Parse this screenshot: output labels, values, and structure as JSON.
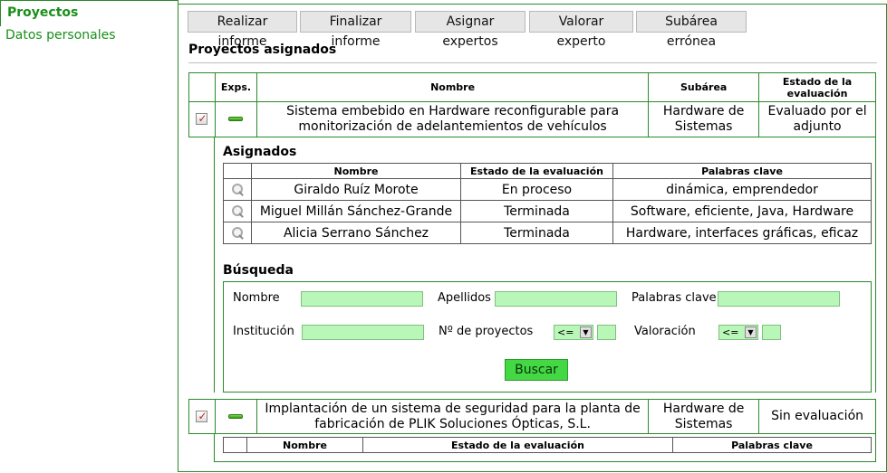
{
  "sidebar": {
    "active_tab": "Proyectos",
    "items": [
      "Datos personales"
    ]
  },
  "toolbar": {
    "realizar": "Realizar informe",
    "finalizar": "Finalizar informe",
    "asignar": "Asignar expertos",
    "valorar": "Valorar experto",
    "subarea": "Subárea errónea"
  },
  "section_title": "Proyectos asignados",
  "projects_header": {
    "exps": "Exps.",
    "nombre": "Nombre",
    "subarea": "Subárea",
    "estado": "Estado de la evaluación"
  },
  "projects": [
    {
      "nombre": "Sistema embebido en Hardware reconfigurable para monitorización de adelantemientos de vehículos",
      "subarea": "Hardware de Sistemas",
      "estado": "Evaluado por el adjunto",
      "checked": true
    },
    {
      "nombre": "Implantación de un sistema de seguridad para la planta de fabricación de PLIK Soluciones Ópticas, S.L.",
      "subarea": "Hardware de Sistemas",
      "estado": "Sin evaluación",
      "checked": true
    }
  ],
  "assigned": {
    "title": "Asignados",
    "headers": {
      "nombre": "Nombre",
      "estado": "Estado de la evaluación",
      "palabras": "Palabras clave"
    },
    "rows": [
      {
        "nombre": "Giraldo Ruíz Morote",
        "estado": "En proceso",
        "palabras": "dinámica, emprendedor"
      },
      {
        "nombre": "Miguel Millán Sánchez-Grande",
        "estado": "Terminada",
        "palabras": "Software, eficiente, Java, Hardware"
      },
      {
        "nombre": "Alicia Serrano Sánchez",
        "estado": "Terminada",
        "palabras": "Hardware, interfaces gráficas, eficaz"
      }
    ]
  },
  "search": {
    "title": "Búsqueda",
    "nombre_label": "Nombre",
    "apellidos_label": "Apellidos",
    "palabras_label": "Palabras clave",
    "institucion_label": "Institución",
    "nproyectos_label": "Nº de proyectos",
    "valoracion_label": "Valoración",
    "nproyectos_op": "<=",
    "valoracion_op": "<=",
    "button": "Buscar"
  },
  "colors": {
    "border_green": "#2a8a2a",
    "link_green": "#1a8f1a",
    "input_green": "#b9f7b9",
    "button_green": "#44d844"
  }
}
